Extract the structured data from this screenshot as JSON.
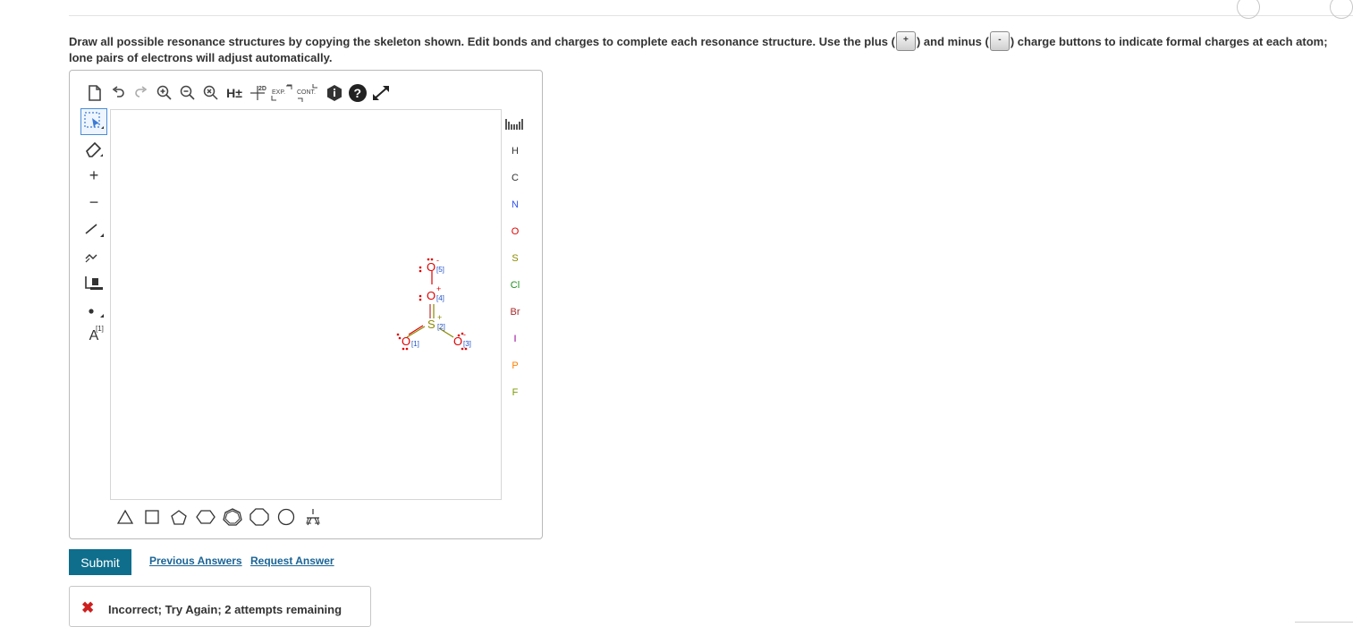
{
  "instructions": {
    "part1": "Draw all possible resonance structures by copying the skeleton shown. Edit bonds and charges to complete each resonance structure. Use the plus (",
    "part2": ") and minus (",
    "part3": ") charge buttons to indicate formal charges at each atom; lone pairs of electrons will adjust automatically.",
    "plus_symbol": "+",
    "minus_symbol": "-"
  },
  "editor": {
    "top_tools": [
      {
        "name": "new-document-icon"
      },
      {
        "name": "undo-icon"
      },
      {
        "name": "redo-icon"
      },
      {
        "name": "zoom-in-icon"
      },
      {
        "name": "zoom-out-icon"
      },
      {
        "name": "zoom-reset-icon"
      },
      {
        "name": "hydrogen-toggle",
        "label": "H±"
      },
      {
        "name": "clean-2d-icon",
        "label": "2D"
      },
      {
        "name": "expand-label",
        "label": "EXP."
      },
      {
        "name": "contract-label",
        "label": "CONT."
      },
      {
        "name": "info-icon"
      },
      {
        "name": "help-icon"
      },
      {
        "name": "fullscreen-icon"
      }
    ],
    "left_tools": [
      {
        "name": "select-tool-icon"
      },
      {
        "name": "eraser-icon"
      },
      {
        "name": "charge-plus-icon",
        "label": "+"
      },
      {
        "name": "charge-minus-icon",
        "label": "−"
      },
      {
        "name": "single-bond-icon"
      },
      {
        "name": "chain-icon"
      },
      {
        "name": "template-icon"
      },
      {
        "name": "radical-dot-icon"
      },
      {
        "name": "atom-map-icon",
        "label": "A",
        "sup": "[1]"
      }
    ],
    "elements": [
      {
        "symbol": "H",
        "color": "#333333"
      },
      {
        "symbol": "C",
        "color": "#333333"
      },
      {
        "symbol": "N",
        "color": "#3050f8"
      },
      {
        "symbol": "O",
        "color": "#e00000"
      },
      {
        "symbol": "S",
        "color": "#8a8a00"
      },
      {
        "symbol": "Cl",
        "color": "#1f8f1f"
      },
      {
        "symbol": "Br",
        "color": "#a62929"
      },
      {
        "symbol": "I",
        "color": "#940094"
      },
      {
        "symbol": "P",
        "color": "#ff8000"
      },
      {
        "symbol": "F",
        "color": "#7a9a00"
      }
    ],
    "shapes": [
      "triangle-icon",
      "square-icon",
      "pentagon-icon",
      "hexagon-icon",
      "heptagon-icon",
      "octagon-icon",
      "cyclopentadiene-icon",
      "benzene-icon"
    ],
    "molecules": [
      {
        "atoms": {
          "O5": "O",
          "O4": "O",
          "S": "S",
          "O1": "O",
          "O3": "O"
        },
        "maps": {
          "O5": "[5]",
          "O4": "[4]",
          "S": "[2]",
          "O1": "[1]",
          "O3": "[3]"
        },
        "charges": {
          "O5": "-",
          "O4": "-"
        }
      },
      {
        "atoms": {
          "O5": "O",
          "O4": "O",
          "S": "S",
          "O1": "O",
          "O3": "O"
        },
        "maps": {
          "O5": "[5]",
          "O4": "[4]",
          "S": "[2]",
          "O1": "[1]",
          "O3": "[3]"
        },
        "charges": {
          "O5": "-",
          "O4": "+",
          "S": "+"
        }
      },
      {
        "atoms": {
          "O5": "O",
          "O4": "O",
          "S": "S",
          "O1": "O",
          "O3": "O"
        },
        "maps": {
          "O5": "[5]",
          "O4": "[4]",
          "S": "[2]",
          "O1": "[1]",
          "O3": "[3]"
        },
        "charges": {
          "O5": "-",
          "O4": "+",
          "S": "+",
          "O3": "-"
        }
      }
    ]
  },
  "actions": {
    "submit_label": "Submit",
    "previous_answers_label": "Previous Answers",
    "request_answer_label": "Request Answer"
  },
  "feedback": {
    "icon": "✖",
    "message": "Incorrect; Try Again; 2 attempts remaining"
  },
  "colors": {
    "submit_bg": "#0e6e8c",
    "link": "#1a6496",
    "oxygen": "#e00000",
    "sulfur": "#8a8a00",
    "map_label": "#2050c8",
    "error": "#cc1f1f"
  }
}
